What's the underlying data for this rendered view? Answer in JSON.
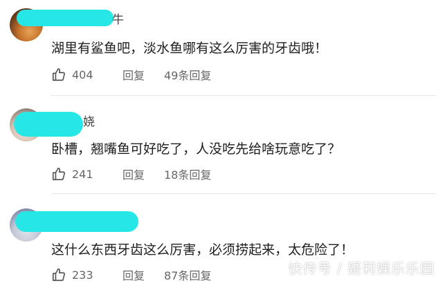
{
  "comments": [
    {
      "name_suffix": "牛",
      "text": "湖里有鲨鱼吧，淡水鱼哪有这么厉害的牙齿哦！",
      "likes": "404",
      "reply_label": "回复",
      "replies_label": "49条回复"
    },
    {
      "name_suffix": "娆",
      "text": "卧槽，翘嘴鱼可好吃了，人没吃先给啥玩意吃了？",
      "likes": "241",
      "reply_label": "回复",
      "replies_label": "18条回复"
    },
    {
      "name_suffix": "",
      "text": "这什么东西牙齿这么厉害，必须捞起来，太危险了！",
      "likes": "233",
      "reply_label": "回复",
      "replies_label": "87条回复"
    }
  ],
  "watermark": "快传号 / 疑莉娱乐乐园",
  "colors": {
    "name_mask": "#27e6e6",
    "separator": "#e6e6e6"
  }
}
